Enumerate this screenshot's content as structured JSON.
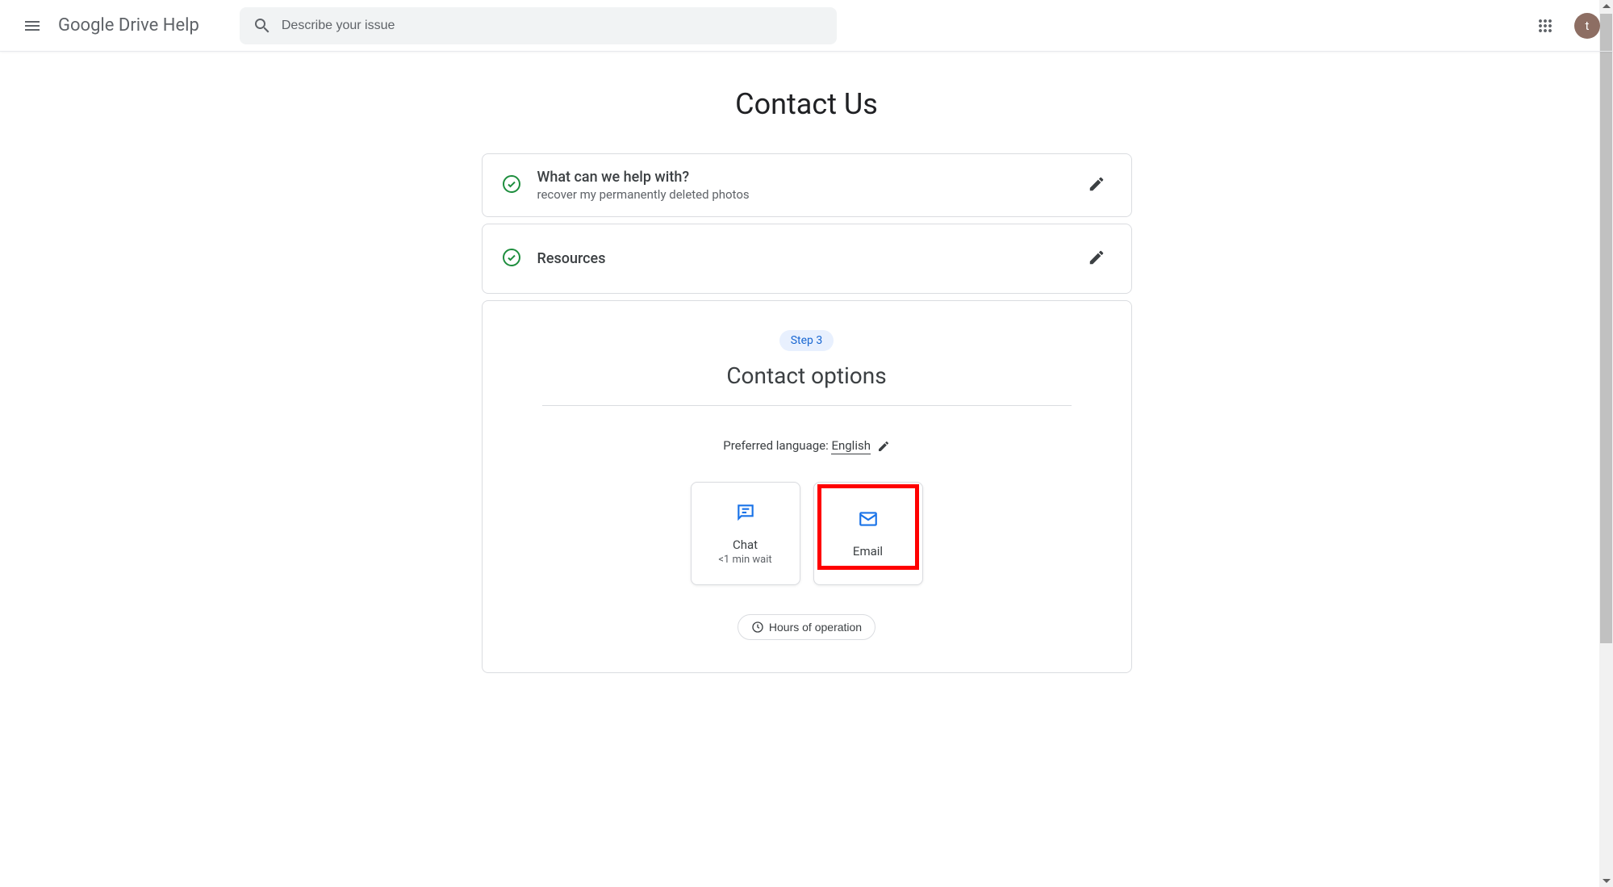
{
  "header": {
    "app_title": "Google Drive Help",
    "search_placeholder": "Describe your issue",
    "avatar_letter": "t"
  },
  "page": {
    "title": "Contact Us"
  },
  "step1": {
    "title": "What can we help with?",
    "subtitle": "recover my permanently deleted photos"
  },
  "step2": {
    "title": "Resources"
  },
  "step3": {
    "badge": "Step 3",
    "heading": "Contact options",
    "language_label": "Preferred language: ",
    "language_value": "English",
    "option_chat": {
      "label": "Chat",
      "sub": "<1 min wait"
    },
    "option_email": {
      "label": "Email"
    },
    "hours_button": "Hours of operation"
  }
}
